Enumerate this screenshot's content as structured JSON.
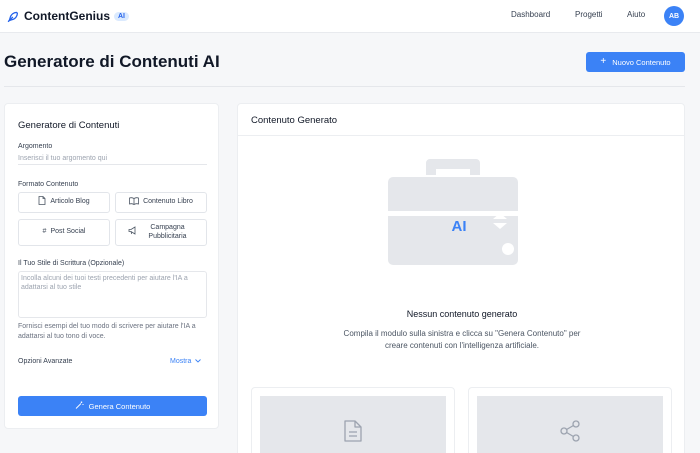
{
  "app": {
    "name": "ContentGenius",
    "badge": "AI",
    "nav": [
      "Dashboard",
      "Progetti",
      "Aiuto"
    ],
    "avatar_initials": "AB"
  },
  "header": {
    "title": "Generatore di Contenuti AI",
    "new_button": "Nuovo Contenuto"
  },
  "form": {
    "title": "Generatore di Contenuti",
    "topic_label": "Argomento",
    "topic_placeholder": "Inserisci il tuo argomento qui",
    "format_label": "Formato Contenuto",
    "formats": [
      "Articolo Blog",
      "Contenuto Libro",
      "Post Social",
      "Campagna Pubblicitaria"
    ],
    "style_label": "Il Tuo Stile di Scrittura (Opzionale)",
    "style_placeholder": "Incolla alcuni dei tuoi testi precedenti per aiutare l'IA a adattarsi al tuo stile",
    "style_help": "Fornisci esempi del tuo modo di scrivere per aiutare l'IA a adattarsi al tuo tono di voce.",
    "advanced_label": "Opzioni Avanzate",
    "advanced_toggle": "Mostra",
    "generate_button": "Genera Contenuto"
  },
  "output": {
    "title": "Contenuto Generato",
    "hero_label": "AI",
    "empty_title": "Nessun contenuto generato",
    "empty_desc": "Compila il modulo sulla sinistra e clicca su \"Genera Contenuto\" per creare contenuti con l'intelligenza artificiale."
  },
  "colors": {
    "accent": "#3b82f6",
    "hero_gray": "#e5e7eb"
  }
}
